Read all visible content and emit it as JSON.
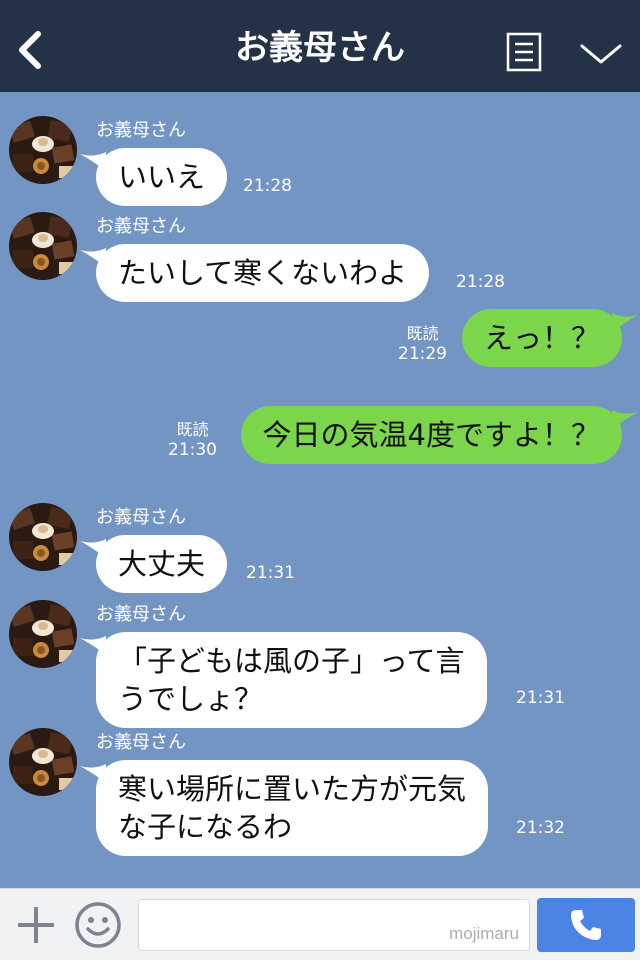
{
  "header": {
    "title": "お義母さん",
    "back_icon": "chevron-left-icon",
    "menu_icon": "list-icon",
    "collapse_icon": "chevron-down-icon"
  },
  "messages": [
    {
      "side": "in",
      "sender": "お義母さん",
      "lines": [
        "いいえ"
      ],
      "time": "21:28"
    },
    {
      "side": "in",
      "sender": "お義母さん",
      "lines": [
        "たいして寒くないわよ"
      ],
      "time": "21:28"
    },
    {
      "side": "out",
      "read": "既読",
      "lines": [
        "えっ！？"
      ],
      "time": "21:29"
    },
    {
      "side": "out",
      "read": "既読",
      "lines": [
        "今日の気温4度ですよ！？"
      ],
      "time": "21:30"
    },
    {
      "side": "in",
      "sender": "お義母さん",
      "lines": [
        "大丈夫"
      ],
      "time": "21:31"
    },
    {
      "side": "in",
      "sender": "お義母さん",
      "lines": [
        "「子どもは風の子」って言",
        "うでしょ？"
      ],
      "time": "21:31"
    },
    {
      "side": "in",
      "sender": "お義母さん",
      "lines": [
        "寒い場所に置いた方が元気",
        "な子になるわ"
      ],
      "time": "21:32"
    }
  ],
  "footer": {
    "plus_icon": "plus-icon",
    "sticker_icon": "smiley-icon",
    "input_value": "",
    "watermark": "mojimaru",
    "send_icon": "phone-icon"
  },
  "colors": {
    "background": "#7295c4",
    "header": "#243248",
    "incoming_bubble": "#ffffff",
    "outgoing_bubble": "#7bd64c",
    "send_button": "#4c84e6"
  }
}
